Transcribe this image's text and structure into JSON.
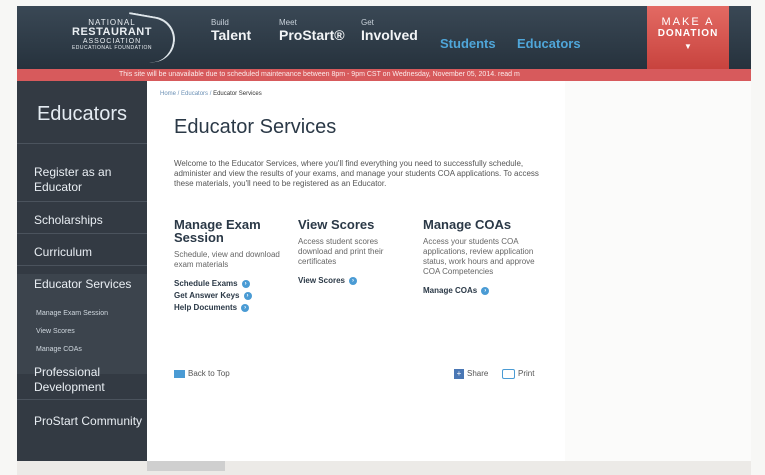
{
  "logo": {
    "line1": "NATIONAL",
    "line2": "RESTAURANT",
    "line3": "ASSOCIATION",
    "line4": "EDUCATIONAL FOUNDATION"
  },
  "nav": [
    {
      "small": "Build",
      "big": "Talent"
    },
    {
      "small": "Meet",
      "big": "ProStart®"
    },
    {
      "small": "Get",
      "big": "Involved"
    },
    {
      "label": "Students"
    },
    {
      "label": "Educators"
    }
  ],
  "donate": {
    "line1": "MAKE A",
    "line2": "DONATION",
    "arrow": "▼"
  },
  "alert": {
    "text": "This site will be unavailable due to scheduled maintenance between 8pm - 9pm CST on Wednesday, November 05, 2014.    read m"
  },
  "sidebar": {
    "title": "Educators",
    "items": [
      "Register as an Educator",
      "Scholarships",
      "Curriculum",
      "Educator Services",
      "Manage Exam Session",
      "View Scores",
      "Manage COAs",
      "Professional Development",
      "ProStart Community"
    ]
  },
  "breadcrumb": {
    "home": "Home",
    "sep1": " / ",
    "educators": "Educators",
    "sep2": " / ",
    "current": "Educator Services"
  },
  "page": {
    "title": "Educator Services",
    "intro": "Welcome to the Educator Services, where you'll find everything you need to successfully schedule, administer and view the results of your exams, and manage your students COA applications. To access these materials, you'll need to be registered as an Educator."
  },
  "columns": [
    {
      "heading": "Manage Exam Session",
      "desc": "Schedule, view and download exam materials",
      "links": [
        "Schedule Exams",
        "Get Answer Keys",
        "Help Documents"
      ]
    },
    {
      "heading": "View Scores",
      "desc": "Access student scores download and print their certificates",
      "links": [
        "View Scores"
      ]
    },
    {
      "heading": "Manage COAs",
      "desc": "Access your students COA applications, review application status, work hours and approve COA Competencies",
      "links": [
        "Manage COAs"
      ]
    }
  ],
  "footer": {
    "back_to_top": "Back to Top",
    "share": "Share",
    "print": "Print"
  },
  "colors": {
    "header": "#2c3a47",
    "donate": "#d9534f",
    "alert": "#d75a5c",
    "sidebar": "#333a43",
    "link_icon": "#4a9bd4"
  }
}
